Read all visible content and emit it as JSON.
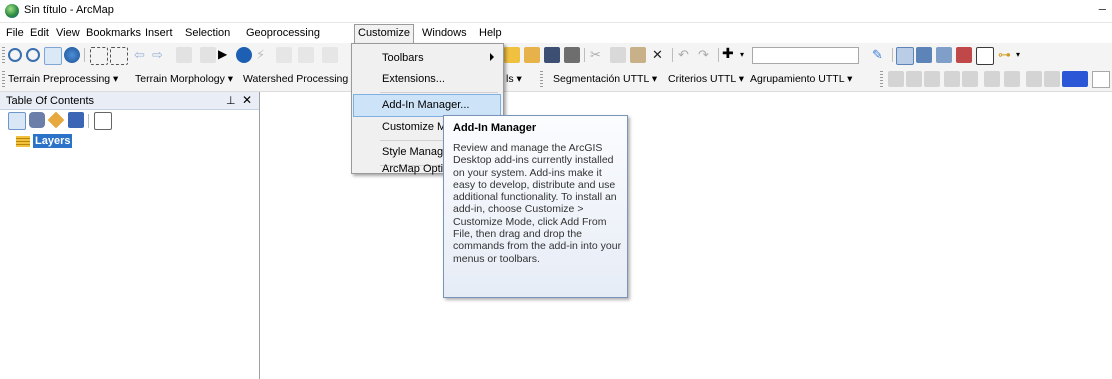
{
  "window": {
    "title": "Sin título - ArcMap",
    "min_symbol": "–"
  },
  "menubar": {
    "items": [
      "File",
      "Edit",
      "View",
      "Bookmarks",
      "Insert",
      "Selection",
      "Geoprocessing",
      "Customize",
      "Windows",
      "Help"
    ],
    "open": "Customize"
  },
  "toolbar2": {
    "left_dropdowns": [
      "Terrain Preprocessing ▾",
      "Terrain Morphology ▾",
      "Watershed Processing ▾"
    ],
    "partial_dropdown": "ls ▾",
    "right_dropdowns": [
      "Segmentación UTTL ▾",
      "Criterios UTTL ▾",
      "Agrupamiento UTTL ▾"
    ]
  },
  "toc": {
    "title": "Table Of Contents",
    "pin": "⊥",
    "close": "✕",
    "layers_label": "Layers"
  },
  "customize_menu": {
    "items": [
      "Toolbars",
      "Extensions...",
      "Add-In Manager...",
      "Customize M",
      "Style Manage",
      "ArcMap Opti"
    ],
    "highlighted": "Add-In Manager..."
  },
  "tooltip": {
    "title": "Add-In Manager",
    "body": "Review and manage the ArcGIS Desktop add-ins currently installed on your system. Add-ins make it easy to develop, distribute and use additional functionality. To install an add-in, choose Customize > Customize Mode, click Add From File, then drag and drop the commands from the add-in into your menus or toolbars."
  },
  "colors": {
    "accent": "#cde3f8",
    "toc_header": "#e9eef6",
    "tooltip_border": "#7b93b9"
  }
}
